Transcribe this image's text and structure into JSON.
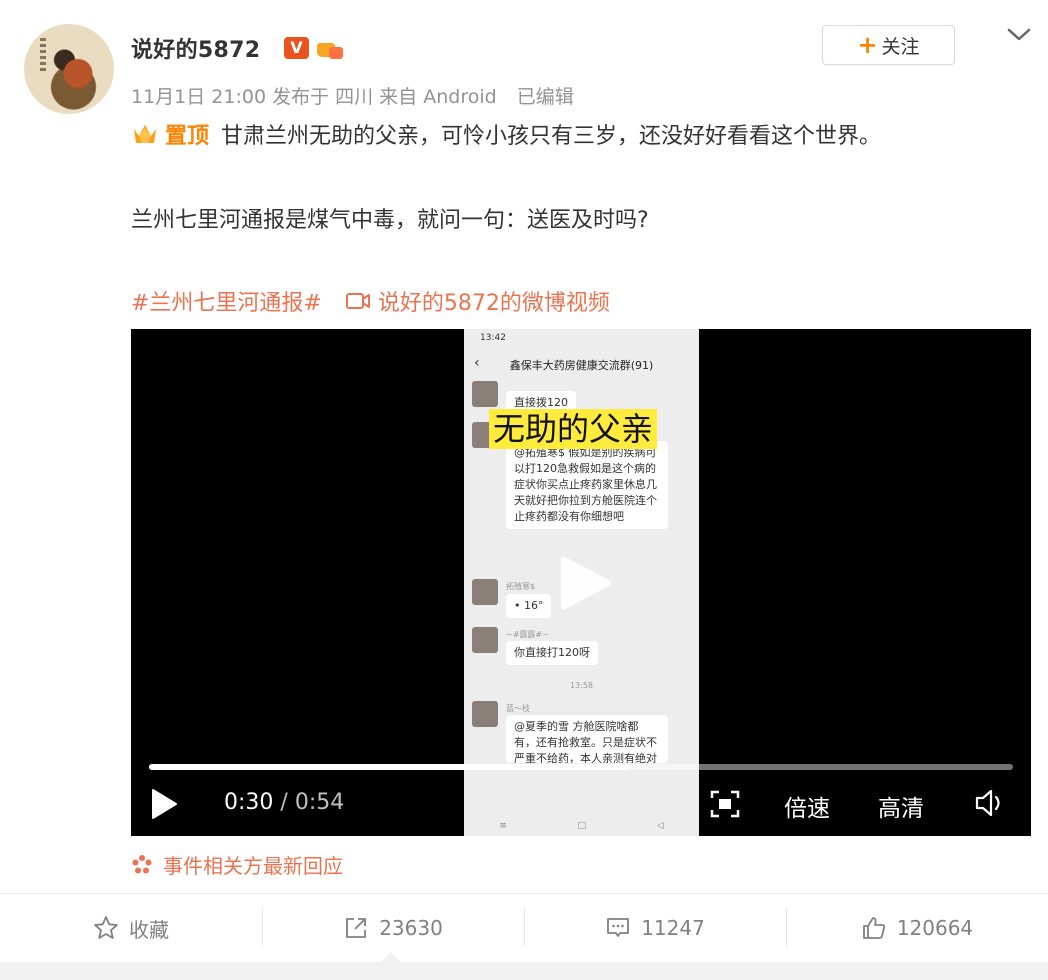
{
  "post": {
    "username": "说好的5872",
    "v_badge": "V",
    "follow_plus": "+",
    "follow_label": "关注",
    "meta": "11月1日 21:00 发布于 四川 来自 Android",
    "edited": "已编辑",
    "pinned_label": "置顶",
    "line1": "甘肃兰州无助的父亲，可怜小孩只有三岁，还没好好看看这个世界。",
    "line2": "兰州七里河通报是煤气中毒，就问一句：送医及时吗?",
    "hashtag": "#兰州七里河通报#",
    "video_link": "说好的5872的微博视频"
  },
  "video": {
    "caption": "无助的父亲",
    "current_time": "0:30",
    "separator": "/",
    "total_time": "0:54",
    "progress": 0.555,
    "speed_label": "倍速",
    "quality_label": "高清",
    "phone": {
      "status_time": "13:42",
      "chat_title": "鑫保丰大药房健康交流群(91)",
      "msg1": "直接拨120",
      "msg2": "@拓殖寒$ 假如是别的疾病可以打120急救假如是这个病的症状你买点止疼药家里休息几天就好把你拉到方舱医院连个止疼药都没有你细想吧",
      "nick1": "拓殖寒$",
      "msg3": "• 16°",
      "nick2": "~#露露#~",
      "msg4": "你直接打120呀",
      "time2": "13:58",
      "nick3": "蓝～枝",
      "msg5": "@夏季的雪 方舱医院啥都有，还有抢救室。只是症状不严重不给药，本人亲测有绝对发言权"
    }
  },
  "event_link": "事件相关方最新回应",
  "footer": {
    "favorite_label": "收藏",
    "repost_count": "23630",
    "comment_count": "11247",
    "like_count": "120664"
  },
  "colors": {
    "accent_orange": "#ff8200",
    "link_red": "#eb7350",
    "v_badge": "#e8531f",
    "caption_bg": "#ffeb3b"
  },
  "icons": [
    "chevron-down-icon",
    "crown-pin-icon",
    "video-camera-icon",
    "play-icon",
    "fullscreen-icon",
    "volume-icon",
    "event-icon",
    "star-icon",
    "repost-icon",
    "comment-icon",
    "like-icon"
  ]
}
